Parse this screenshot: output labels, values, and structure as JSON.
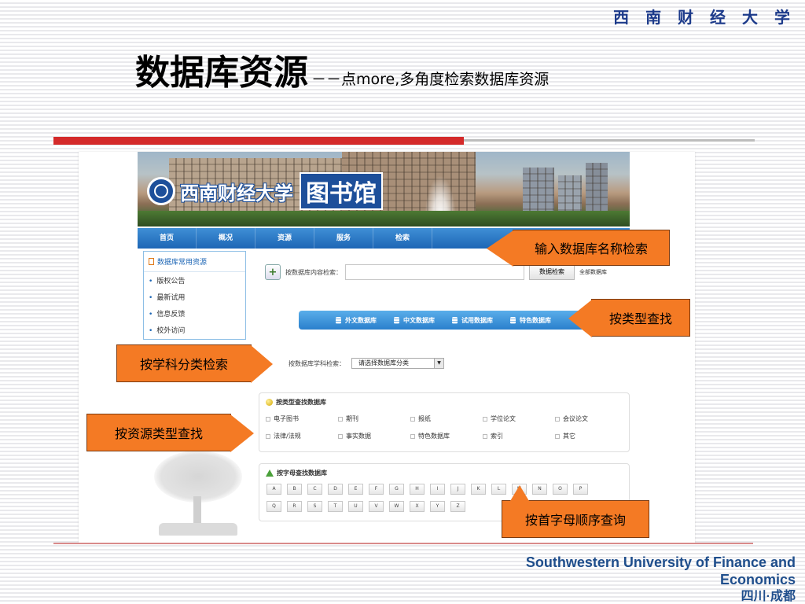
{
  "slide": {
    "university_cn": "西 南 财 经 大 学",
    "title_main": "数据库资源",
    "title_sub": "－－点more,多角度检索数据库资源",
    "university_en": "Southwestern University of Finance and Economics",
    "city": "四川·成都"
  },
  "site": {
    "brand_name": "西南财经大学",
    "library_name": "图书馆",
    "nav": [
      "首页",
      "概况",
      "资源",
      "服务",
      "检索"
    ]
  },
  "sidebar": {
    "title": "数据库常用资源",
    "items": [
      "版权公告",
      "最新试用",
      "信息反馈",
      "校外访问"
    ]
  },
  "search": {
    "label": "按数据库内容检索：",
    "input_value": "",
    "button": "数据检索",
    "scope": "全部数据库"
  },
  "tabs": [
    "外文数据库",
    "中文数据库",
    "试用数据库",
    "特色数据库"
  ],
  "subject": {
    "label": "按数据库学科检索：",
    "selected": "请选择数据库分类"
  },
  "type_box": {
    "title": "按类型查找数据库",
    "types": [
      "电子图书",
      "期刊",
      "报纸",
      "学位论文",
      "会议论文",
      "法律/法规",
      "事实数据",
      "特色数据库",
      "索引",
      "其它"
    ]
  },
  "letter_box": {
    "title": "按字母查找数据库",
    "letters": [
      "A",
      "B",
      "C",
      "D",
      "E",
      "F",
      "G",
      "H",
      "I",
      "J",
      "K",
      "L",
      "M",
      "N",
      "O",
      "P",
      "Q",
      "R",
      "S",
      "T",
      "U",
      "V",
      "W",
      "X",
      "Y",
      "Z"
    ]
  },
  "callouts": {
    "name_search": "输入数据库名称检索",
    "type_find": "按类型查找",
    "subject_search": "按学科分类检索",
    "resource_type": "按资源类型查找",
    "alpha_query": "按首字母顺序查询"
  },
  "colors": {
    "accent_red": "#d42a2a",
    "nav_blue": "#1d66b5",
    "callout_orange": "#f47a24",
    "title_blue": "#1c3a8a"
  }
}
